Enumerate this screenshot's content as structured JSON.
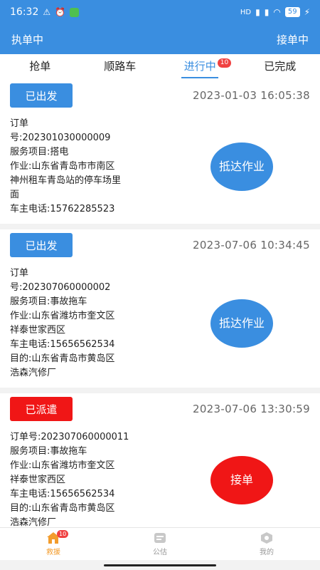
{
  "status_bar": {
    "time": "16:32",
    "signal": "HD",
    "battery": "59"
  },
  "app_bar": {
    "left": "执单中",
    "right": "接单中"
  },
  "tabs": [
    {
      "label": "抢单"
    },
    {
      "label": "顺路车"
    },
    {
      "label": "进行中",
      "badge": "10"
    },
    {
      "label": "已完成"
    }
  ],
  "orders": [
    {
      "status": "已出发",
      "status_color": "#3a8ee0",
      "time": "2023-01-03 16:05:38",
      "lines": [
        "订单",
        "号:202301030000009",
        "服务项目:搭电",
        "作业:山东省青岛市市南区",
        "神州租车青岛站的停车场里",
        "面",
        "车主电话:15762285523"
      ],
      "action": "抵达作业",
      "action_color": "#3a8ee0"
    },
    {
      "status": "已出发",
      "status_color": "#3a8ee0",
      "time": "2023-07-06 10:34:45",
      "lines": [
        "订单",
        "号:202307060000002",
        "服务项目:事故拖车",
        "作业:山东省潍坊市奎文区",
        "祥泰世家西区",
        "车主电话:15656562534",
        "目的:山东省青岛市黄岛区",
        "浩森汽修厂"
      ],
      "action": "抵达作业",
      "action_color": "#3a8ee0"
    },
    {
      "status": "已派遣",
      "status_color": "#f01616",
      "time": "2023-07-06 13:30:59",
      "lines": [
        "订单号:202307060000011",
        "服务项目:事故拖车",
        "作业:山东省潍坊市奎文区",
        "祥泰世家西区",
        "车主电话:15656562534",
        "目的:山东省青岛市黄岛区",
        "浩森汽修厂"
      ],
      "action": "接单",
      "action_color": "#f01616"
    }
  ],
  "bottom_nav": [
    {
      "label": "救援",
      "icon": "home-icon",
      "badge": "10"
    },
    {
      "label": "公估",
      "icon": "document-icon"
    },
    {
      "label": "我的",
      "icon": "profile-icon"
    }
  ]
}
